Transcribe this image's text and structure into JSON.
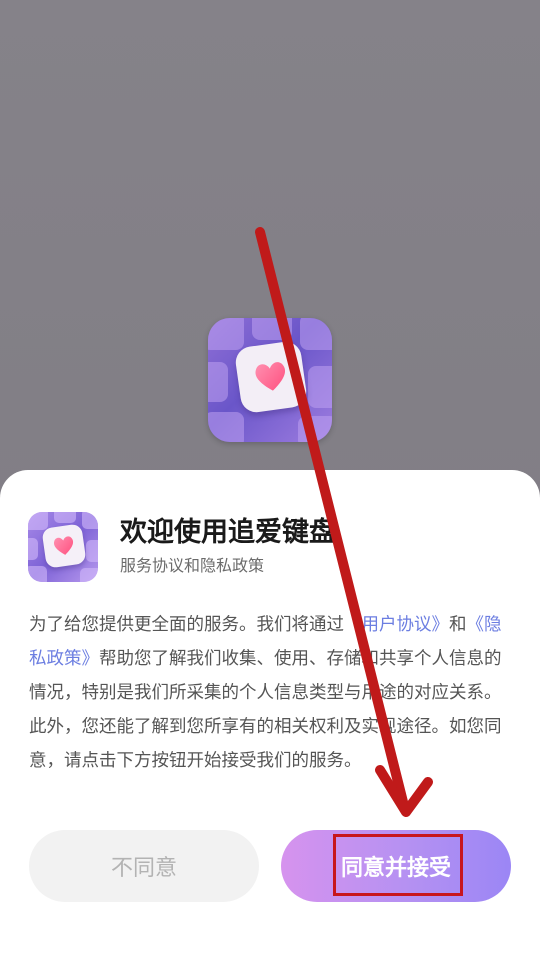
{
  "dialog": {
    "title": "欢迎使用追爱键盘",
    "subtitle": "服务协议和隐私政策",
    "body": {
      "part1": "为了给您提供更全面的服务。我们将通过",
      "link_user_agreement": "《用户协议》",
      "part2": "和",
      "link_privacy_policy": "《隐私政策》",
      "part3": "帮助您了解我们收集、使用、存储和共享个人信息的情况，特别是我们所采集的个人信息类型与用途的对应关系。此外，您还能了解到您所享有的相关权利及实现途径。如您同意，请点击下方按钮开始接受我们的服务。"
    },
    "decline_label": "不同意",
    "accept_label": "同意并接受"
  },
  "icons": {
    "app_icon": "heart-keyboard-app-icon"
  },
  "colors": {
    "link": "#6c7ee1",
    "accept_gradient_start": "#d693ee",
    "accept_gradient_end": "#9b86f5",
    "annotation_red": "#c8161d"
  }
}
